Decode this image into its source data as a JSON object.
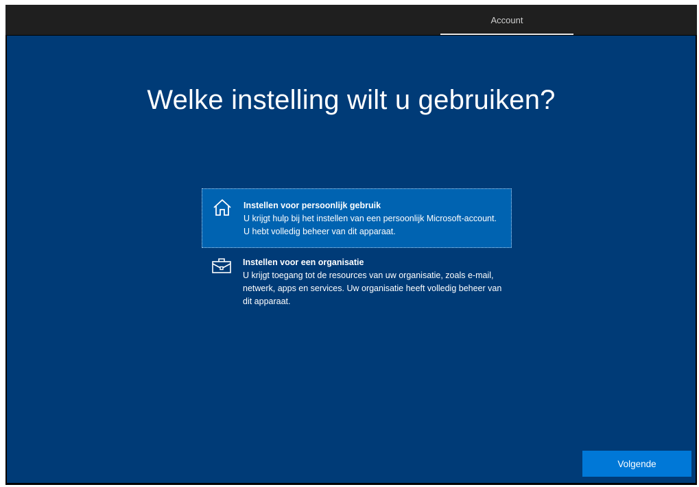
{
  "header": {
    "active_tab": "Account"
  },
  "main": {
    "title": "Welke instelling wilt u gebruiken?",
    "options": [
      {
        "icon": "home-icon",
        "heading": "Instellen voor persoonlijk gebruik",
        "description": "U krijgt hulp bij het instellen van een persoonlijk Microsoft-account. U hebt volledig beheer van dit apparaat.",
        "selected": true
      },
      {
        "icon": "briefcase-icon",
        "heading": "Instellen voor een organisatie",
        "description": "U krijgt toegang tot de resources van uw organisatie, zoals e-mail, netwerk, apps en services. Uw organisatie heeft volledig beheer van dit apparaat.",
        "selected": false
      }
    ]
  },
  "footer": {
    "next_label": "Volgende"
  },
  "colors": {
    "background": "#003b77",
    "topbar": "#1f1f1f",
    "selected_option": "#0063b1",
    "accent_button": "#0078d7"
  }
}
